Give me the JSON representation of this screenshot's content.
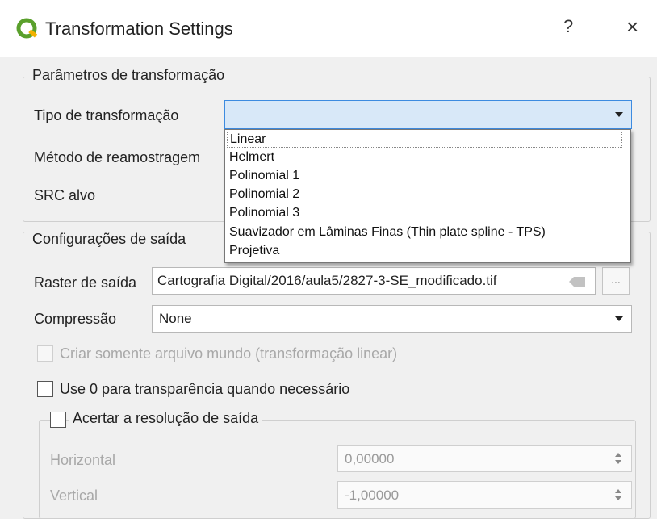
{
  "window": {
    "title": "Transformation Settings",
    "help_label": "?",
    "close_label": "×",
    "accent_color": "#3d8be0",
    "icon": "qgis-icon"
  },
  "params_group": {
    "title": "Parâmetros de transformação",
    "transform_type_label": "Tipo de transformação",
    "transform_type_value": "",
    "resampling_label": "Método de reamostragem",
    "target_srs_label": "SRC alvo"
  },
  "transform_options": [
    "Linear",
    "Helmert",
    "Polinomial 1",
    "Polinomial 2",
    "Polinomial 3",
    "Suavizador em Lâminas Finas (Thin plate spline - TPS)",
    "Projetiva"
  ],
  "output_group": {
    "title": "Configurações de saída",
    "raster_label": "Raster de saída",
    "raster_value": "Cartografia Digital/2016/aula5/2827-3-SE_modificado.tif",
    "browse_label": "...",
    "compression_label": "Compressão",
    "compression_value": "None",
    "world_file_label": "Criar somente arquivo mundo (transformação linear)",
    "use_zero_label": "Use 0 para transparência quando necessário"
  },
  "resolution_group": {
    "title": "Acertar a resolução de saída",
    "horizontal_label": "Horizontal",
    "horizontal_value": "0,00000",
    "vertical_label": "Vertical",
    "vertical_value": "-1,00000"
  }
}
